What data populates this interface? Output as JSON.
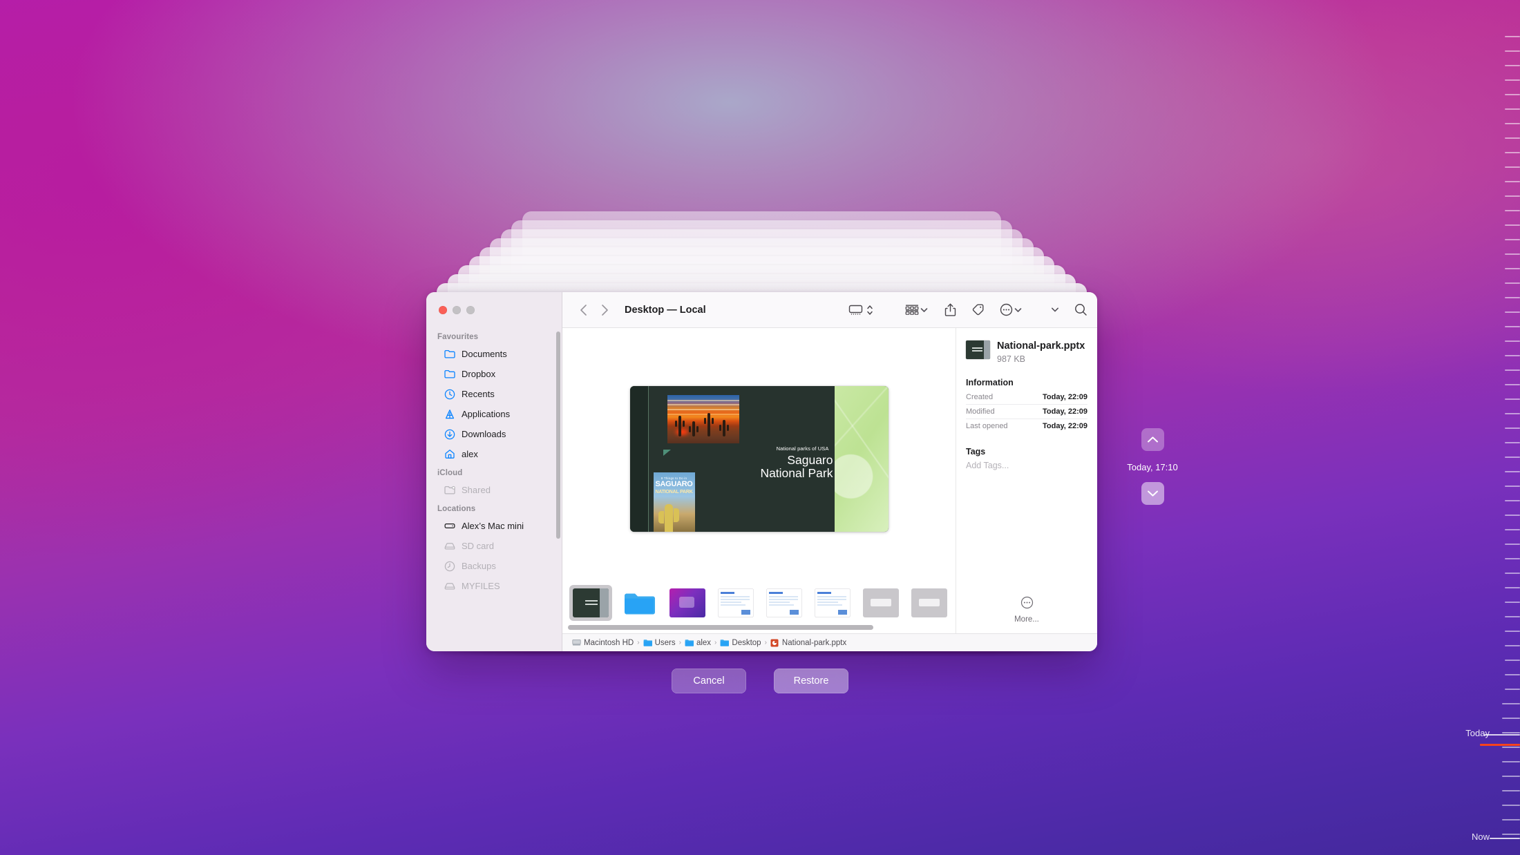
{
  "desktop": {
    "wallpaper_colors": [
      "#b41fae",
      "#a8b2cd",
      "#7a30bc",
      "#43289c"
    ]
  },
  "finder": {
    "title": "Desktop — Local",
    "traffic_lights": [
      "close",
      "minimize",
      "zoom"
    ],
    "toolbar": {
      "back": "back-icon",
      "forward": "forward-icon",
      "view_display": "display-icon",
      "view_stepper": "stepper-icon",
      "group_view": "grid-view-icon",
      "group_chevron": "chevron-down-icon",
      "share": "share-icon",
      "tag": "tag-icon",
      "more": "ellipsis-circle-icon",
      "more_chevron": "chevron-down-icon",
      "extra_chevron": "chevron-down-icon",
      "search": "search-icon"
    },
    "sidebar": {
      "sections": [
        {
          "title": "Favourites",
          "items": [
            {
              "label": "Documents",
              "icon": "folder-icon",
              "dim": false
            },
            {
              "label": "Dropbox",
              "icon": "folder-icon",
              "dim": false
            },
            {
              "label": "Recents",
              "icon": "clock-icon",
              "dim": false
            },
            {
              "label": "Applications",
              "icon": "applications-icon",
              "dim": false
            },
            {
              "label": "Downloads",
              "icon": "download-icon",
              "dim": false
            },
            {
              "label": "alex",
              "icon": "home-icon",
              "dim": false
            }
          ]
        },
        {
          "title": "iCloud",
          "items": [
            {
              "label": "Shared",
              "icon": "shared-folder-icon",
              "dim": true
            }
          ]
        },
        {
          "title": "Locations",
          "items": [
            {
              "label": "Alex’s Mac mini",
              "icon": "computer-icon",
              "dim": false
            },
            {
              "label": "SD card",
              "icon": "drive-icon",
              "dim": true
            },
            {
              "label": "Backups",
              "icon": "time-machine-icon",
              "dim": true
            },
            {
              "label": "MYFILES",
              "icon": "drive-icon",
              "dim": true
            }
          ]
        }
      ]
    },
    "preview": {
      "slide": {
        "kicker": "National parks of USA",
        "title_line1": "Saguaro",
        "title_line2": "National Park",
        "book_title": "8 Things to Do in",
        "book_main": "SAGUARO",
        "book_sub": "NATIONAL PARK"
      }
    },
    "thumbnails": [
      {
        "name": "National-park.pptx",
        "kind": "slide",
        "selected": true
      },
      {
        "name": "folder",
        "kind": "folder",
        "selected": false
      },
      {
        "name": "wallpaper",
        "kind": "wallpaper",
        "selected": false
      },
      {
        "name": "document-1",
        "kind": "document",
        "selected": false
      },
      {
        "name": "document-2",
        "kind": "document",
        "selected": false
      },
      {
        "name": "document-3",
        "kind": "document",
        "selected": false
      },
      {
        "name": "document-4",
        "kind": "gray",
        "selected": false
      },
      {
        "name": "document-5",
        "kind": "gray",
        "selected": false
      }
    ],
    "info": {
      "filename": "National-park.pptx",
      "filesize": "987 KB",
      "information_heading": "Information",
      "rows": [
        {
          "key": "Created",
          "value": "Today, 22:09"
        },
        {
          "key": "Modified",
          "value": "Today, 22:09"
        },
        {
          "key": "Last opened",
          "value": "Today, 22:09"
        }
      ],
      "tags_heading": "Tags",
      "add_tags_placeholder": "Add Tags...",
      "more_label": "More..."
    },
    "path_bar": [
      {
        "label": "Macintosh HD",
        "icon": "hard-drive-icon"
      },
      {
        "label": "Users",
        "icon": "folder-icon"
      },
      {
        "label": "alex",
        "icon": "folder-icon"
      },
      {
        "label": "Desktop",
        "icon": "folder-icon"
      },
      {
        "label": "National-park.pptx",
        "icon": "powerpoint-icon"
      }
    ]
  },
  "time_machine": {
    "cancel_label": "Cancel",
    "restore_label": "Restore",
    "nav_up": "chevron-up-icon",
    "nav_down": "chevron-down-icon",
    "current_snapshot": "Today, 17:10",
    "timeline": {
      "top_label": "Today",
      "bottom_label": "Now",
      "current_tick_color": "#f8431c"
    }
  }
}
